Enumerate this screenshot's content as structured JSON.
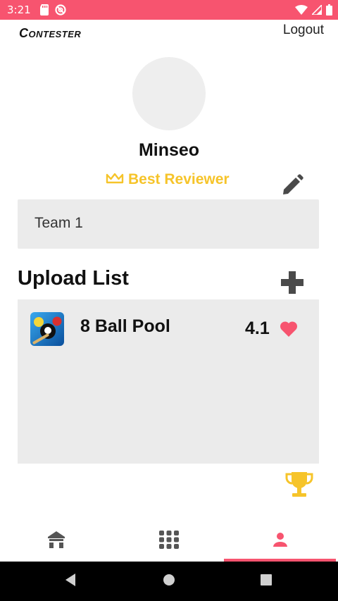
{
  "status_bar": {
    "time": "3:21",
    "background_color": "#f7546f",
    "left_icons": [
      "sd-card-icon",
      "do-not-disturb-icon"
    ],
    "right_icons": [
      "wifi-icon",
      "signal-icon",
      "battery-icon"
    ]
  },
  "header": {
    "logo_text": "Contester",
    "logout_label": "Logout"
  },
  "profile": {
    "username": "Minseo",
    "badge_label": "Best Reviewer",
    "badge_color": "#f6c42a",
    "team_label": "Team 1"
  },
  "uploads": {
    "title": "Upload List",
    "items": [
      {
        "name": "8 Ball Pool",
        "score": "4.1",
        "heart_color": "#f7546f"
      }
    ]
  },
  "bottom_nav": {
    "items": [
      "home-icon",
      "grid-icon",
      "person-icon"
    ],
    "active_index": 2,
    "accent_color": "#f7546f"
  },
  "system_nav": [
    "back-icon",
    "home-circle-icon",
    "recents-icon"
  ]
}
